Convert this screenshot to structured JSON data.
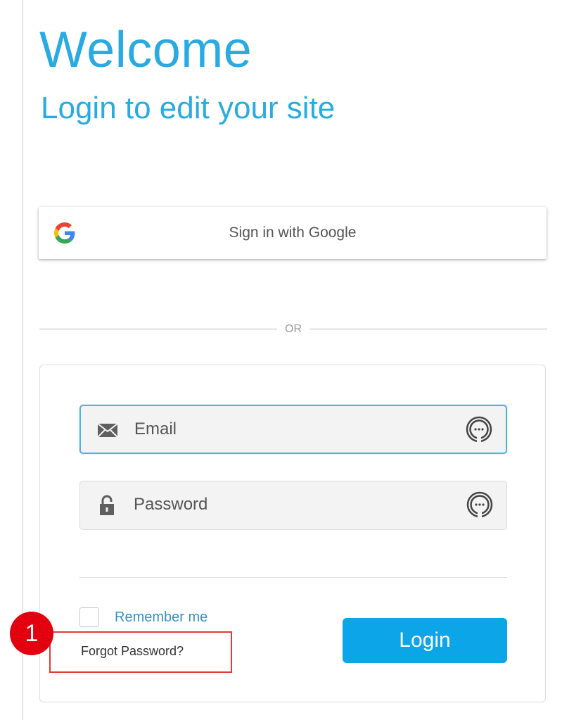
{
  "header": {
    "welcome": "Welcome",
    "subtitle": "Login to edit your site"
  },
  "google_signin": {
    "label": "Sign in with Google",
    "icon": "google-icon"
  },
  "divider": {
    "text": "OR"
  },
  "form": {
    "email": {
      "placeholder": "Email",
      "value": "",
      "icon": "envelope-icon",
      "right_icon": "password-manager-icon"
    },
    "password": {
      "placeholder": "Password",
      "value": "",
      "icon": "lock-icon",
      "right_icon": "password-manager-icon"
    },
    "remember_label": "Remember me",
    "forgot_label": "Forgot Password?",
    "login_label": "Login"
  },
  "annotation": {
    "marker": "1"
  },
  "colors": {
    "accent": "#29abe2",
    "button": "#0ba5e8",
    "link": "#3a8fc7",
    "marker": "#e3000f",
    "highlight": "#e53935"
  }
}
